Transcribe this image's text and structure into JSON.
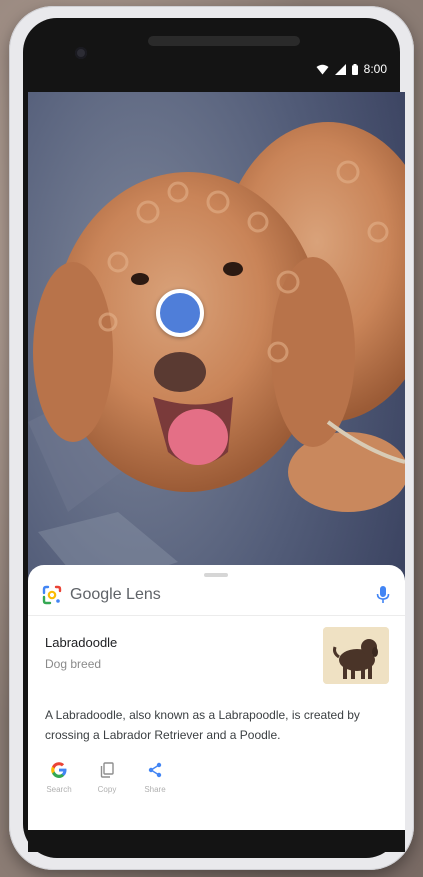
{
  "status_bar": {
    "time": "8:00",
    "icons": [
      "wifi-icon",
      "cell-signal-icon",
      "battery-icon"
    ]
  },
  "lens": {
    "brand_google": "Google",
    "brand_lens": "Lens",
    "mic_icon": "mic-icon",
    "logo_icon": "google-lens-logo-icon"
  },
  "result": {
    "title": "Labradoodle",
    "subtitle": "Dog breed",
    "description": "A Labradoodle, also known as a Labrapoodle, is created by crossing a Labrador Retriever and a Poodle."
  },
  "actions": [
    {
      "label": "Search",
      "icon": "google-g-icon"
    },
    {
      "label": "Copy",
      "icon": "copy-icon"
    },
    {
      "label": "Share",
      "icon": "share-icon"
    }
  ],
  "colors": {
    "focus_dot": "#4f7ed9",
    "mic": "#4285f4",
    "google_blue": "#4285f4",
    "google_red": "#ea4335",
    "google_yellow": "#fbbc05",
    "google_green": "#34a853"
  }
}
